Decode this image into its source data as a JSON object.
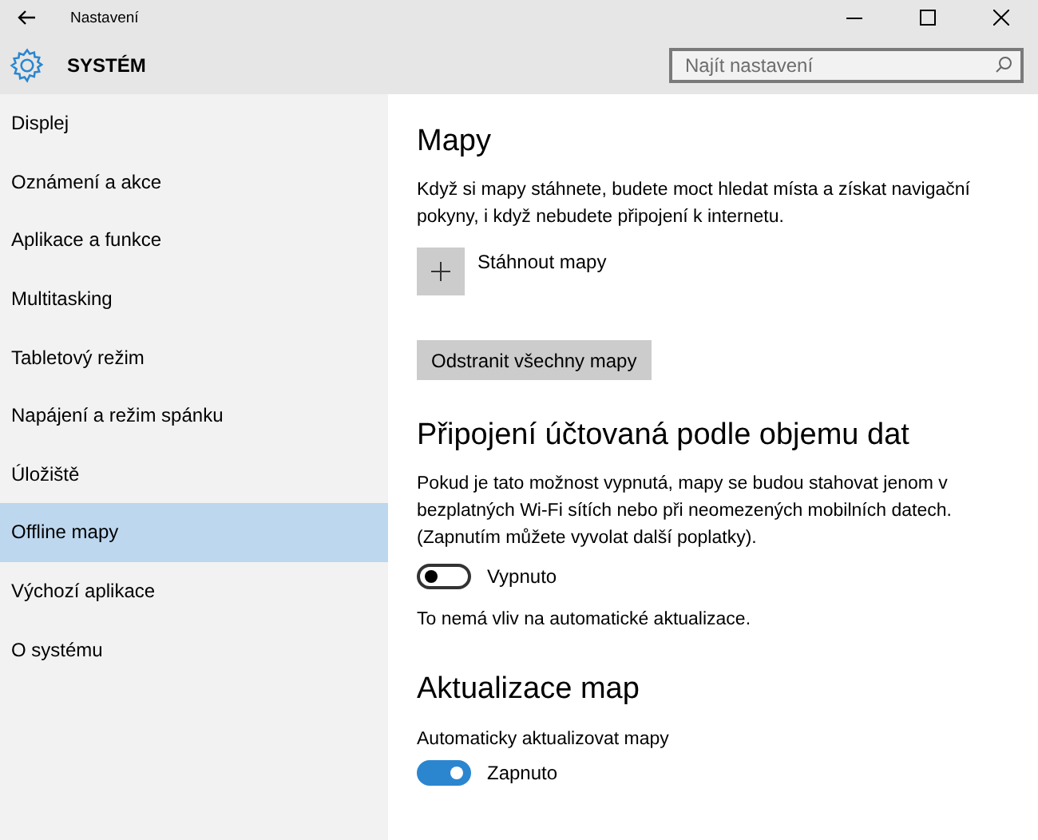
{
  "window": {
    "title": "Nastavení"
  },
  "header": {
    "title": "SYSTÉM",
    "search": {
      "placeholder": "Najít nastavení"
    }
  },
  "sidebar": {
    "items": [
      {
        "label": "Displej",
        "selected": false
      },
      {
        "label": "Oznámení a akce",
        "selected": false
      },
      {
        "label": "Aplikace a funkce",
        "selected": false
      },
      {
        "label": "Multitasking",
        "selected": false
      },
      {
        "label": "Tabletový režim",
        "selected": false
      },
      {
        "label": "Napájení a režim spánku",
        "selected": false
      },
      {
        "label": "Úložiště",
        "selected": false
      },
      {
        "label": "Offline mapy",
        "selected": true
      },
      {
        "label": "Výchozí aplikace",
        "selected": false
      },
      {
        "label": "O systému",
        "selected": false
      }
    ]
  },
  "content": {
    "sections": [
      {
        "title": "Mapy",
        "items": [
          {
            "kind": "text",
            "text": "Když si mapy stáhnete, budete moct hledat místa a získat navigační pokyny, i když nebudete připojení k internetu."
          },
          {
            "kind": "add",
            "label": "Stáhnout mapy"
          },
          {
            "kind": "button",
            "label": "Odstranit všechny mapy"
          }
        ]
      },
      {
        "title": "Připojení účtovaná podle objemu dat",
        "items": [
          {
            "kind": "text",
            "text": "Pokud je tato možnost vypnutá, mapy se budou stahovat jenom v bezplatných Wi-Fi sítích nebo při neomezených mobilních datech. (Zapnutím můžete vyvolat další poplatky)."
          },
          {
            "kind": "toggle",
            "on": false,
            "label": "Vypnuto"
          },
          {
            "kind": "text",
            "text": "To nemá vliv na automatické aktualizace."
          }
        ]
      },
      {
        "title": "Aktualizace map",
        "items": [
          {
            "kind": "label",
            "text": "Automaticky aktualizovat mapy"
          },
          {
            "kind": "toggle",
            "on": true,
            "label": "Zapnuto"
          }
        ]
      }
    ]
  }
}
